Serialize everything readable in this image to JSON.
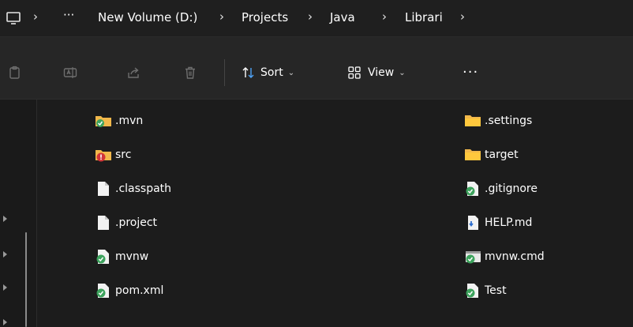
{
  "breadcrumb": {
    "overflow": "···",
    "items": [
      "New Volume (D:)",
      "Projects",
      "Java",
      "Librari"
    ],
    "separator": "›"
  },
  "toolbar": {
    "sort_label": "Sort",
    "view_label": "View",
    "more_label": "···",
    "chevron": "⌄"
  },
  "files": {
    "left": [
      {
        "name": ".mvn",
        "icon": "folder-check-icon"
      },
      {
        "name": "src",
        "icon": "folder-error-icon"
      },
      {
        "name": ".classpath",
        "icon": "file-icon"
      },
      {
        "name": ".project",
        "icon": "file-icon"
      },
      {
        "name": "mvnw",
        "icon": "file-check-icon"
      },
      {
        "name": "pom.xml",
        "icon": "file-check-icon"
      }
    ],
    "right": [
      {
        "name": ".settings",
        "icon": "folder-icon"
      },
      {
        "name": "target",
        "icon": "folder-icon"
      },
      {
        "name": ".gitignore",
        "icon": "file-check-icon"
      },
      {
        "name": "HELP.md",
        "icon": "markdown-file-icon"
      },
      {
        "name": "mvnw.cmd",
        "icon": "cmd-check-icon"
      },
      {
        "name": "Test",
        "icon": "file-check-icon"
      }
    ]
  },
  "colors": {
    "folder": "#f2b84b",
    "check_badge": "#3da35d",
    "error_badge": "#d13438"
  }
}
